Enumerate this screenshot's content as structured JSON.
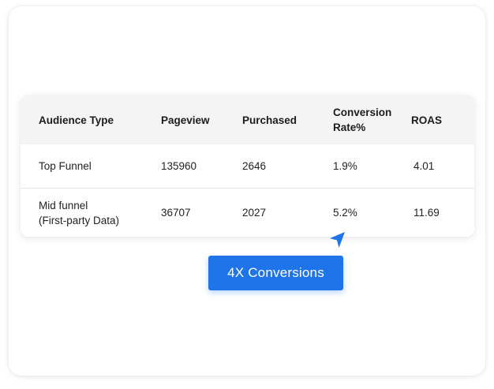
{
  "table": {
    "headers": [
      "Audience Type",
      "Pageview",
      "Purchased",
      "Conversion\nRate%",
      "ROAS"
    ],
    "rows": [
      [
        "Top Funnel",
        "135960",
        "2646",
        "1.9%",
        "4.01"
      ],
      [
        "Mid funnel\n(First-party Data)",
        "36707",
        "2027",
        "5.2%",
        "11.69"
      ]
    ]
  },
  "cta": {
    "label": "4X Conversions"
  },
  "colors": {
    "accent": "#1e74e8",
    "header_bg": "#f4f4f4",
    "background": "#ffffff"
  },
  "icons": {
    "cursor": "cursor-arrow-icon"
  }
}
